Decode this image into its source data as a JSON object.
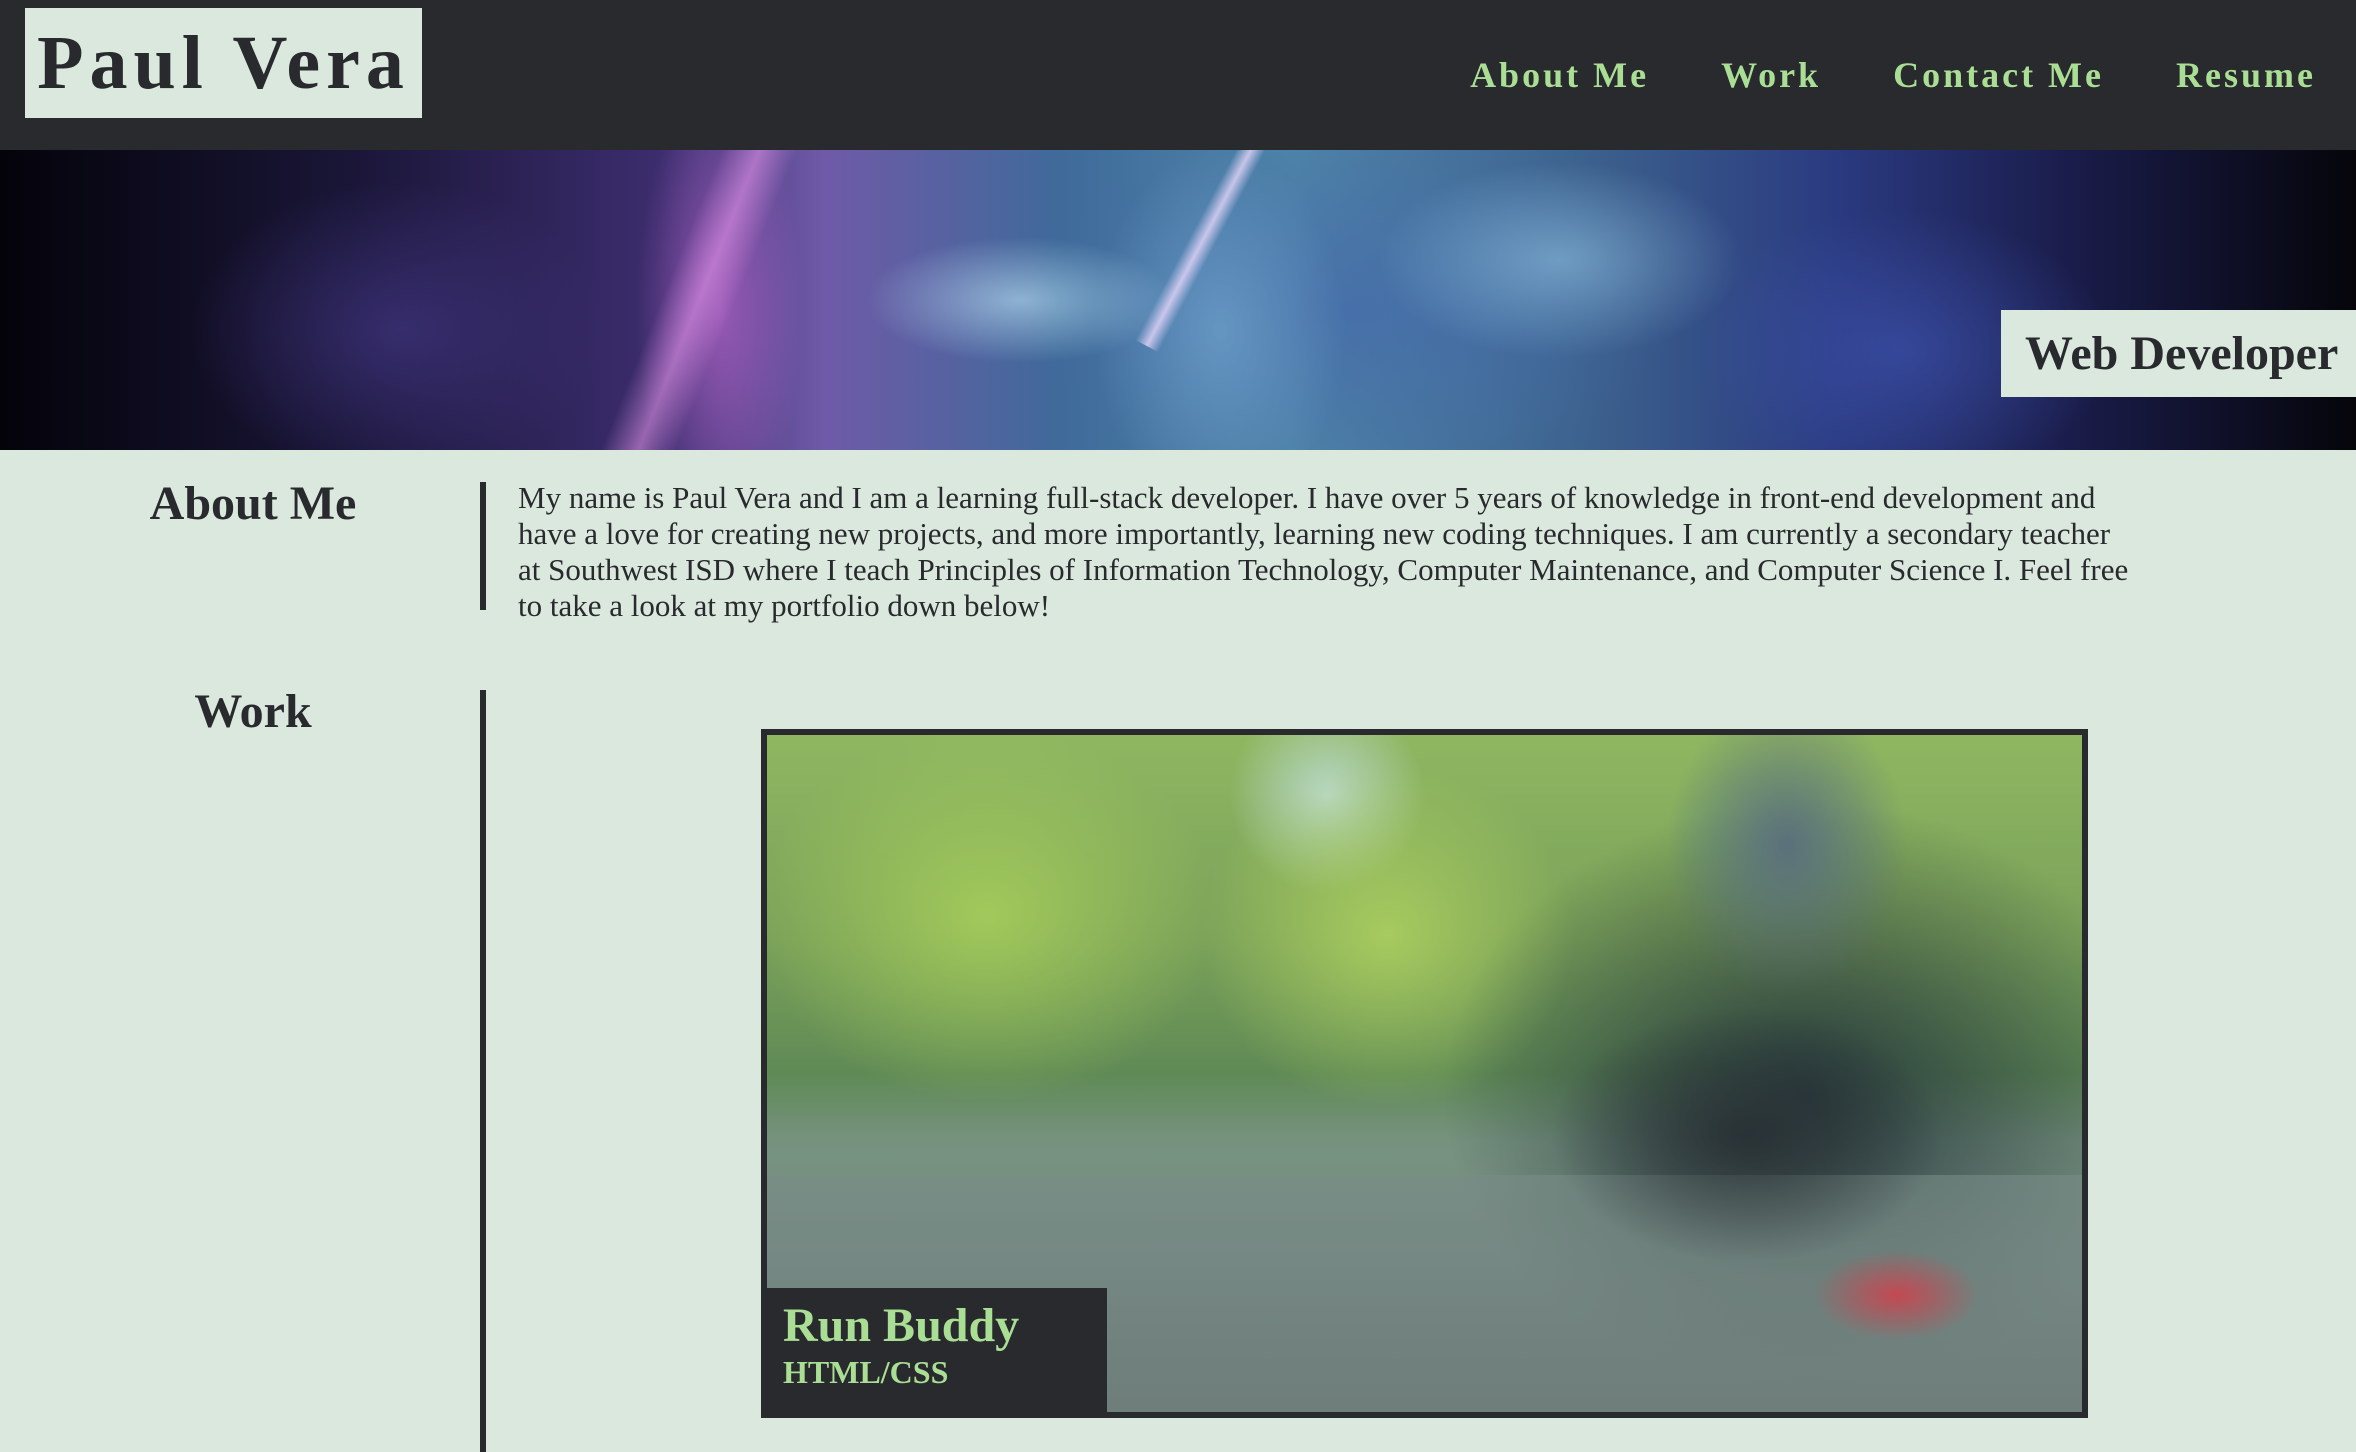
{
  "header": {
    "logo": "Paul Vera",
    "nav": [
      {
        "label": "About Me"
      },
      {
        "label": "Work"
      },
      {
        "label": "Contact Me"
      },
      {
        "label": "Resume"
      }
    ]
  },
  "hero": {
    "badge": "Web Developer"
  },
  "about": {
    "title": "About Me",
    "text": "My name is Paul Vera and I am a learning full-stack developer. I have over 5 years of knowledge in front-end development and have a love for creating new projects, and more importantly, learning new coding techniques. I am currently a secondary teacher at Southwest ISD where I teach Principles of Information Technology, Computer Maintenance, and Computer Science I. Feel free to take a look at my portfolio down below!"
  },
  "work": {
    "title": "Work",
    "projects": [
      {
        "title": "Run Buddy",
        "tech": "HTML/CSS"
      }
    ]
  },
  "colors": {
    "background": "#dbe8dd",
    "dark": "#282a2e",
    "accent": "#a9de94"
  }
}
